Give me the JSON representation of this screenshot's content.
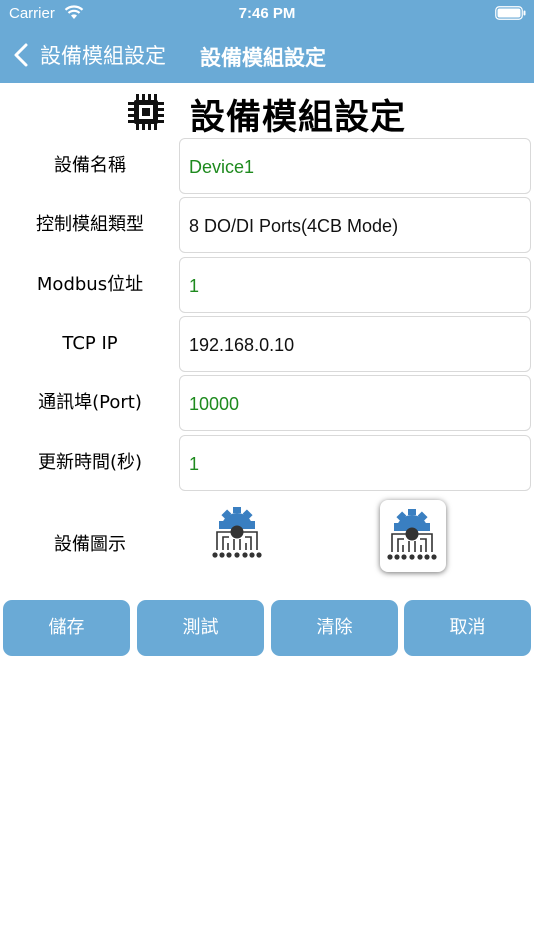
{
  "status_bar": {
    "carrier": "Carrier",
    "time": "7:46 PM"
  },
  "nav": {
    "back_label": "設備模組設定",
    "title": "設備模組設定"
  },
  "header": {
    "title": "設備模組設定"
  },
  "form": {
    "name": {
      "label": "設備名稱",
      "value": "Device1"
    },
    "module_type": {
      "label": "控制模組類型",
      "value": "8 DO/DI Ports(4CB Mode)"
    },
    "modbus": {
      "label": "Modbus位址",
      "value": "1"
    },
    "tcp_ip": {
      "label": "TCP IP",
      "value": "192.168.0.10"
    },
    "port": {
      "label": "通訊埠(Port)",
      "value": "10000"
    },
    "refresh": {
      "label": "更新時間(秒)",
      "value": "1"
    },
    "device_icon": {
      "label": "設備圖示",
      "options": [
        "device-gear-icon",
        "device-gear-icon"
      ],
      "selected_index": 1
    }
  },
  "buttons": {
    "save": "儲存",
    "test": "測試",
    "clear": "清除",
    "cancel": "取消"
  },
  "colors": {
    "accent": "#6aaad6",
    "value_green": "#1e8a1e",
    "icon_blue": "#3a7fc1",
    "icon_dark": "#333333"
  }
}
